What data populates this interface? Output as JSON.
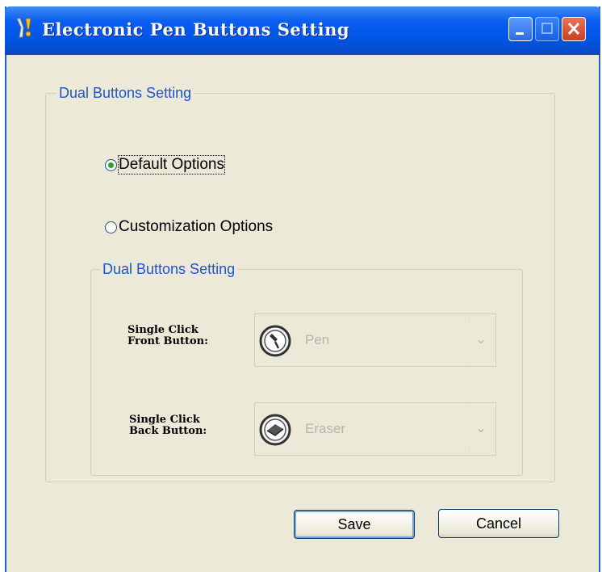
{
  "window": {
    "title": "Electronic Pen Buttons Setting"
  },
  "outer_group": {
    "label": "Dual Buttons Setting",
    "options": [
      {
        "label": "Default Options",
        "checked": true
      },
      {
        "label": "Customization Options",
        "checked": false
      }
    ]
  },
  "inner_group": {
    "label": "Dual Buttons Setting",
    "front": {
      "label_line1": "Single Click",
      "label_line2": "Front Button:",
      "value": "Pen",
      "icon": "pen-icon"
    },
    "back": {
      "label_line1": "Single Click",
      "label_line2": "Back Button:",
      "value": "Eraser",
      "icon": "eraser-icon"
    }
  },
  "buttons": {
    "save": "Save",
    "cancel": "Cancel"
  },
  "colors": {
    "titlebar": "#0054e3",
    "group_label": "#1e56c8",
    "dialog_bg": "#ece9d8",
    "disabled_text": "#b5b5a8"
  }
}
